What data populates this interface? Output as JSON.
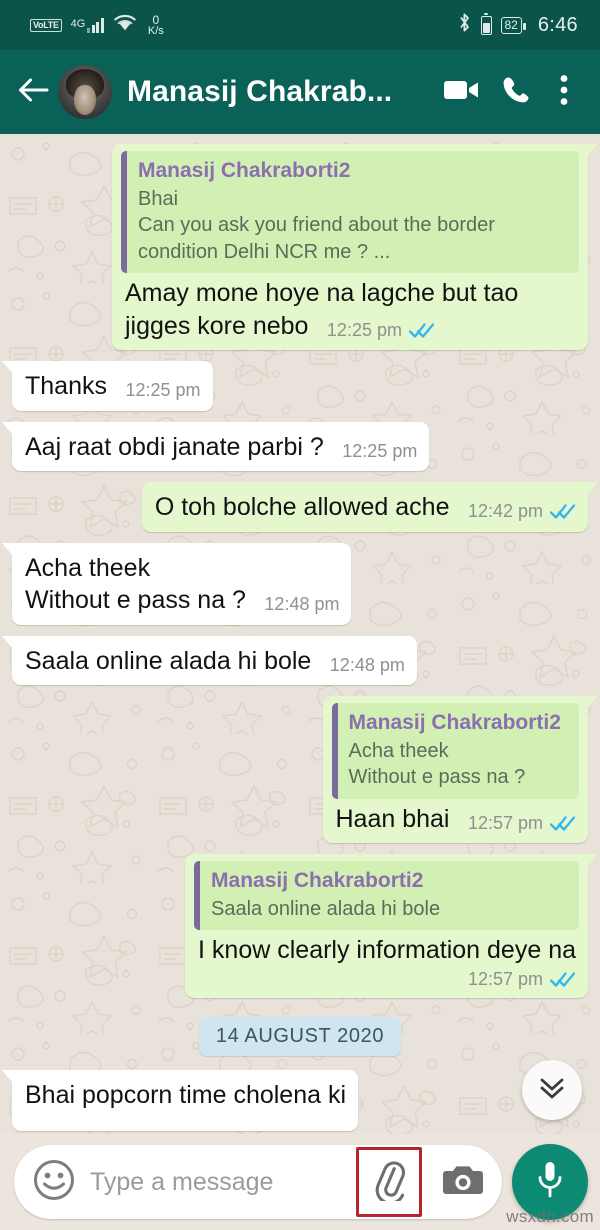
{
  "status_bar": {
    "volte_label": "VoLTE",
    "network_type": "4G",
    "network_speed_value": "0",
    "network_speed_unit": "K/s",
    "battery_percent": "82",
    "clock": "6:46"
  },
  "header": {
    "title": "Manasij Chakrab...",
    "back_icon": "back-arrow-icon",
    "avatar_alt": "contact-avatar",
    "video_call_icon": "video-camera-icon",
    "voice_call_icon": "phone-icon",
    "overflow_icon": "three-dots-menu-icon"
  },
  "chat": {
    "messages": [
      {
        "id": "m1",
        "direction": "out",
        "quote": {
          "author": "Manasij Chakraborti2",
          "text": "Bhai\nCan you ask you friend about the border condition Delhi NCR me ? ..."
        },
        "text": "Amay mone hoye na lagche but tao jigges kore nebo",
        "time": "12:25 pm",
        "status": "read",
        "meta_position": "inline"
      },
      {
        "id": "m2",
        "direction": "in",
        "text": "Thanks",
        "time": "12:25 pm",
        "meta_position": "inline"
      },
      {
        "id": "m3",
        "direction": "in",
        "text": "Aaj raat obdi janate parbi ?",
        "time": "12:25 pm",
        "meta_position": "inline"
      },
      {
        "id": "m4",
        "direction": "out",
        "text": "O toh bolche allowed ache",
        "time": "12:42 pm",
        "status": "read",
        "meta_position": "inline"
      },
      {
        "id": "m5",
        "direction": "in",
        "text": "Acha theek\nWithout e pass na ?",
        "time": "12:48 pm",
        "meta_position": "inline"
      },
      {
        "id": "m6",
        "direction": "in",
        "text": "Saala online alada hi bole",
        "time": "12:48 pm",
        "meta_position": "inline"
      },
      {
        "id": "m7",
        "direction": "out",
        "quote": {
          "author": "Manasij Chakraborti2",
          "text": "Acha theek\nWithout e pass na ?"
        },
        "text": "Haan bhai",
        "time": "12:57 pm",
        "status": "read",
        "meta_position": "inline"
      },
      {
        "id": "m8",
        "direction": "out",
        "quote": {
          "author": "Manasij Chakraborti2",
          "text": "Saala online alada hi bole"
        },
        "text": "I know clearly information deye na",
        "time": "12:57 pm",
        "status": "read",
        "meta_position": "below"
      }
    ],
    "date_divider": "14 AUGUST 2020",
    "partial_message": {
      "direction": "in",
      "text": "Bhai popcorn time cholena ki"
    },
    "scroll_to_bottom_icon": "double-chevron-down-icon"
  },
  "input_bar": {
    "emoji_icon": "smiley-face-icon",
    "placeholder": "Type a message",
    "attach_icon": "paperclip-icon",
    "camera_icon": "camera-icon",
    "mic_icon": "microphone-icon"
  },
  "watermark": "wsxdn.com",
  "colors": {
    "status_bar_bg": "#0b5449",
    "header_bg": "#0a6157",
    "chat_bg": "#e9e2da",
    "outgoing_bubble": "#e4f7cd",
    "incoming_bubble": "#ffffff",
    "quote_bg": "#d3f0b4",
    "quote_bar": "#7d6a9c",
    "quote_author": "#8b6fae",
    "date_badge_bg": "#cfe5ef",
    "tick_blue": "#34b7f1",
    "mic_button": "#0d8a73",
    "highlight_box": "#b5242f"
  }
}
